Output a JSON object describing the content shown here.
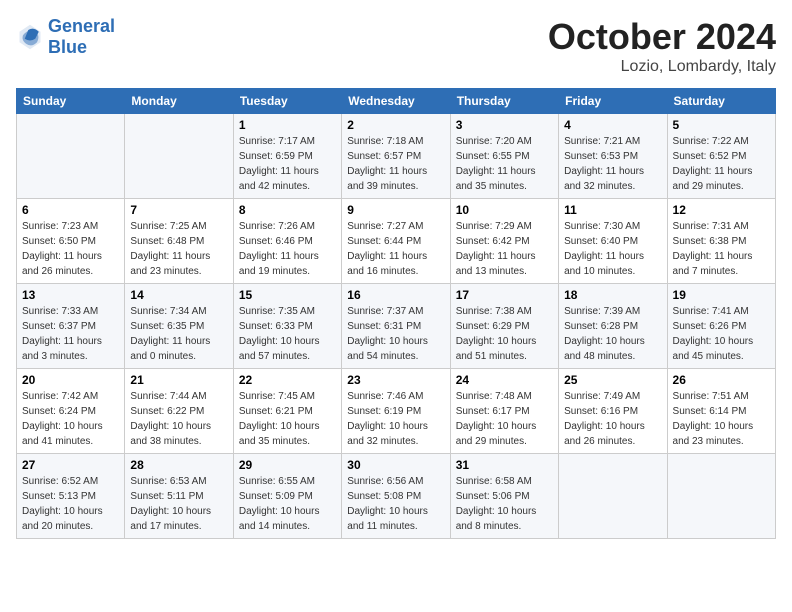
{
  "header": {
    "logo_line1": "General",
    "logo_line2": "Blue",
    "month": "October 2024",
    "location": "Lozio, Lombardy, Italy"
  },
  "weekdays": [
    "Sunday",
    "Monday",
    "Tuesday",
    "Wednesday",
    "Thursday",
    "Friday",
    "Saturday"
  ],
  "weeks": [
    [
      {
        "day": "",
        "sunrise": "",
        "sunset": "",
        "daylight": ""
      },
      {
        "day": "",
        "sunrise": "",
        "sunset": "",
        "daylight": ""
      },
      {
        "day": "1",
        "sunrise": "Sunrise: 7:17 AM",
        "sunset": "Sunset: 6:59 PM",
        "daylight": "Daylight: 11 hours and 42 minutes."
      },
      {
        "day": "2",
        "sunrise": "Sunrise: 7:18 AM",
        "sunset": "Sunset: 6:57 PM",
        "daylight": "Daylight: 11 hours and 39 minutes."
      },
      {
        "day": "3",
        "sunrise": "Sunrise: 7:20 AM",
        "sunset": "Sunset: 6:55 PM",
        "daylight": "Daylight: 11 hours and 35 minutes."
      },
      {
        "day": "4",
        "sunrise": "Sunrise: 7:21 AM",
        "sunset": "Sunset: 6:53 PM",
        "daylight": "Daylight: 11 hours and 32 minutes."
      },
      {
        "day": "5",
        "sunrise": "Sunrise: 7:22 AM",
        "sunset": "Sunset: 6:52 PM",
        "daylight": "Daylight: 11 hours and 29 minutes."
      }
    ],
    [
      {
        "day": "6",
        "sunrise": "Sunrise: 7:23 AM",
        "sunset": "Sunset: 6:50 PM",
        "daylight": "Daylight: 11 hours and 26 minutes."
      },
      {
        "day": "7",
        "sunrise": "Sunrise: 7:25 AM",
        "sunset": "Sunset: 6:48 PM",
        "daylight": "Daylight: 11 hours and 23 minutes."
      },
      {
        "day": "8",
        "sunrise": "Sunrise: 7:26 AM",
        "sunset": "Sunset: 6:46 PM",
        "daylight": "Daylight: 11 hours and 19 minutes."
      },
      {
        "day": "9",
        "sunrise": "Sunrise: 7:27 AM",
        "sunset": "Sunset: 6:44 PM",
        "daylight": "Daylight: 11 hours and 16 minutes."
      },
      {
        "day": "10",
        "sunrise": "Sunrise: 7:29 AM",
        "sunset": "Sunset: 6:42 PM",
        "daylight": "Daylight: 11 hours and 13 minutes."
      },
      {
        "day": "11",
        "sunrise": "Sunrise: 7:30 AM",
        "sunset": "Sunset: 6:40 PM",
        "daylight": "Daylight: 11 hours and 10 minutes."
      },
      {
        "day": "12",
        "sunrise": "Sunrise: 7:31 AM",
        "sunset": "Sunset: 6:38 PM",
        "daylight": "Daylight: 11 hours and 7 minutes."
      }
    ],
    [
      {
        "day": "13",
        "sunrise": "Sunrise: 7:33 AM",
        "sunset": "Sunset: 6:37 PM",
        "daylight": "Daylight: 11 hours and 3 minutes."
      },
      {
        "day": "14",
        "sunrise": "Sunrise: 7:34 AM",
        "sunset": "Sunset: 6:35 PM",
        "daylight": "Daylight: 11 hours and 0 minutes."
      },
      {
        "day": "15",
        "sunrise": "Sunrise: 7:35 AM",
        "sunset": "Sunset: 6:33 PM",
        "daylight": "Daylight: 10 hours and 57 minutes."
      },
      {
        "day": "16",
        "sunrise": "Sunrise: 7:37 AM",
        "sunset": "Sunset: 6:31 PM",
        "daylight": "Daylight: 10 hours and 54 minutes."
      },
      {
        "day": "17",
        "sunrise": "Sunrise: 7:38 AM",
        "sunset": "Sunset: 6:29 PM",
        "daylight": "Daylight: 10 hours and 51 minutes."
      },
      {
        "day": "18",
        "sunrise": "Sunrise: 7:39 AM",
        "sunset": "Sunset: 6:28 PM",
        "daylight": "Daylight: 10 hours and 48 minutes."
      },
      {
        "day": "19",
        "sunrise": "Sunrise: 7:41 AM",
        "sunset": "Sunset: 6:26 PM",
        "daylight": "Daylight: 10 hours and 45 minutes."
      }
    ],
    [
      {
        "day": "20",
        "sunrise": "Sunrise: 7:42 AM",
        "sunset": "Sunset: 6:24 PM",
        "daylight": "Daylight: 10 hours and 41 minutes."
      },
      {
        "day": "21",
        "sunrise": "Sunrise: 7:44 AM",
        "sunset": "Sunset: 6:22 PM",
        "daylight": "Daylight: 10 hours and 38 minutes."
      },
      {
        "day": "22",
        "sunrise": "Sunrise: 7:45 AM",
        "sunset": "Sunset: 6:21 PM",
        "daylight": "Daylight: 10 hours and 35 minutes."
      },
      {
        "day": "23",
        "sunrise": "Sunrise: 7:46 AM",
        "sunset": "Sunset: 6:19 PM",
        "daylight": "Daylight: 10 hours and 32 minutes."
      },
      {
        "day": "24",
        "sunrise": "Sunrise: 7:48 AM",
        "sunset": "Sunset: 6:17 PM",
        "daylight": "Daylight: 10 hours and 29 minutes."
      },
      {
        "day": "25",
        "sunrise": "Sunrise: 7:49 AM",
        "sunset": "Sunset: 6:16 PM",
        "daylight": "Daylight: 10 hours and 26 minutes."
      },
      {
        "day": "26",
        "sunrise": "Sunrise: 7:51 AM",
        "sunset": "Sunset: 6:14 PM",
        "daylight": "Daylight: 10 hours and 23 minutes."
      }
    ],
    [
      {
        "day": "27",
        "sunrise": "Sunrise: 6:52 AM",
        "sunset": "Sunset: 5:13 PM",
        "daylight": "Daylight: 10 hours and 20 minutes."
      },
      {
        "day": "28",
        "sunrise": "Sunrise: 6:53 AM",
        "sunset": "Sunset: 5:11 PM",
        "daylight": "Daylight: 10 hours and 17 minutes."
      },
      {
        "day": "29",
        "sunrise": "Sunrise: 6:55 AM",
        "sunset": "Sunset: 5:09 PM",
        "daylight": "Daylight: 10 hours and 14 minutes."
      },
      {
        "day": "30",
        "sunrise": "Sunrise: 6:56 AM",
        "sunset": "Sunset: 5:08 PM",
        "daylight": "Daylight: 10 hours and 11 minutes."
      },
      {
        "day": "31",
        "sunrise": "Sunrise: 6:58 AM",
        "sunset": "Sunset: 5:06 PM",
        "daylight": "Daylight: 10 hours and 8 minutes."
      },
      {
        "day": "",
        "sunrise": "",
        "sunset": "",
        "daylight": ""
      },
      {
        "day": "",
        "sunrise": "",
        "sunset": "",
        "daylight": ""
      }
    ]
  ]
}
